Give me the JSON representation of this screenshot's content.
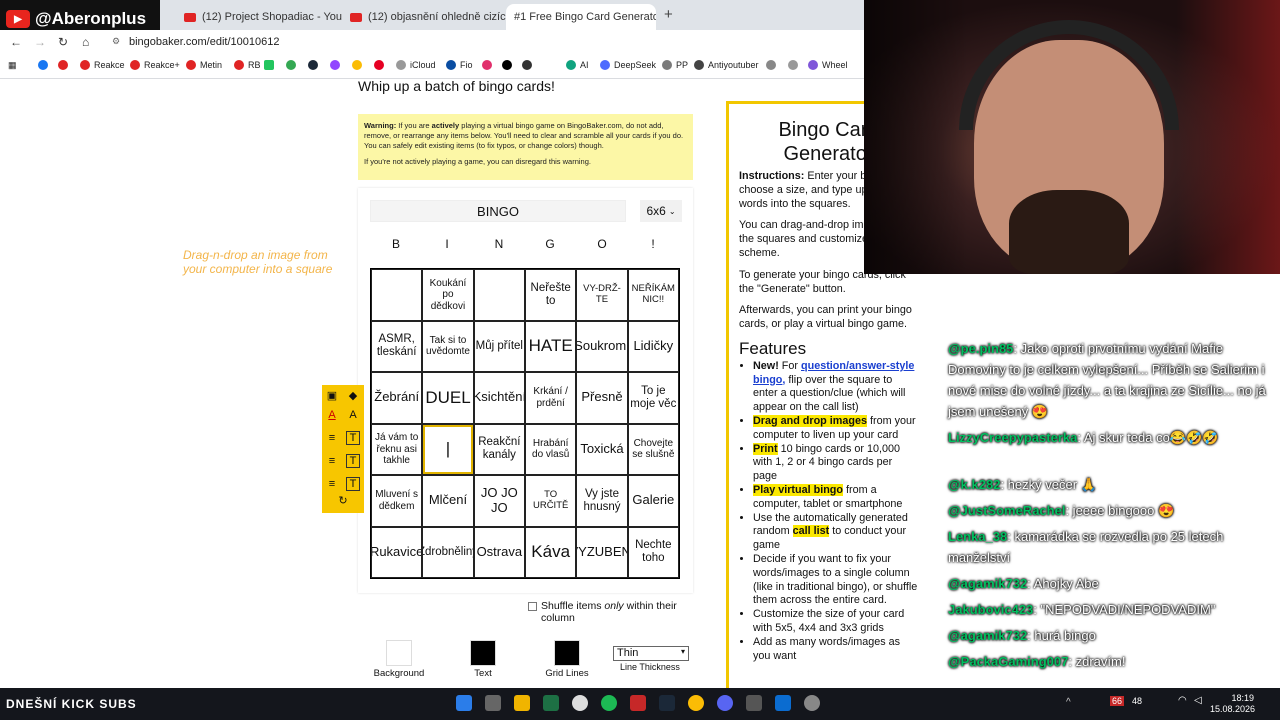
{
  "browser": {
    "tabs": [
      {
        "label": "(12) Project Shopadiac - YouTu"
      },
      {
        "label": "(12) objasnění ohledně cizích li"
      },
      {
        "label": "#1 Free Bingo Card Generator"
      }
    ],
    "url": "bingobaker.com/edit/10010612",
    "bookmarks": [
      "Reakce",
      "Reakce+",
      "Metin",
      "RB",
      "iCloud",
      "Fio",
      "AI",
      "DeepSeek",
      "PP",
      "Antiyoutuber",
      "Wheel"
    ]
  },
  "channel": {
    "name": "@Aberonplus"
  },
  "page": {
    "heading": "Whip up a batch of bingo cards!",
    "warning": {
      "label": "Warning:",
      "body_pre": " If you are ",
      "body_em": "actively",
      "body_post": " playing a virtual bingo game on BingoBaker.com, do not add, remove, or rearrange any items below. You'll need to clear and scramble all your cards if you do. You can safely edit existing items (to fix typos, or change colors) though.",
      "note": "If you're not actively playing a game, you can disregard this warning."
    },
    "card_title": "BINGO",
    "size": "6x6",
    "letters": [
      "B",
      "I",
      "N",
      "G",
      "O",
      "!"
    ],
    "grid": [
      [
        "",
        "Koukání po dědkovi",
        "",
        "Neřešte to",
        "VY-DRŽ-TE",
        "NEŘÍKÁM NIC!!"
      ],
      [
        "ASMR, tleskání",
        "Tak si to uvědomte",
        "Můj přítel",
        "HATE",
        "Soukromí",
        "Lidičky"
      ],
      [
        "Žebrání",
        "DUEL",
        "Ksichtění",
        "Krkání / prdění",
        "Přesně",
        "To je moje věc"
      ],
      [
        "Já vám to řeknu asi takhle",
        "|",
        "Reakční kanály",
        "Hrabání do vlasů",
        "Toxická",
        "Chovejte se slušně"
      ],
      [
        "Mluvení s dědkem",
        "Mlčení",
        "JO JO JO",
        "TO URČITĚ",
        "Vy jste hnusný",
        "Galerie"
      ],
      [
        "Rukavice",
        "Zdrobněliny",
        "Ostrava",
        "Káva",
        "VYZUBENÍ",
        "Nechte toho"
      ]
    ],
    "drag_hint": "Drag-n-drop an image from your computer into a square",
    "shuffle_pre": "Shuffle items ",
    "shuffle_em": "only",
    "shuffle_post": " within their column",
    "swatches": [
      {
        "label": "Background",
        "color": "#ffffff"
      },
      {
        "label": "Text",
        "color": "#000000"
      },
      {
        "label": "Grid Lines",
        "color": "#000000"
      }
    ],
    "thickness": {
      "value": "Thin",
      "label": "Line Thickness"
    }
  },
  "panel": {
    "title_line1": "Bingo Card",
    "title_line2": "Generator",
    "instructions_label": "Instructions:",
    "instructions": " Enter your bingo title, choose a size, and type up your words into the squares.",
    "dragdrop": "You can drag-and-drop images into the squares and customize the color scheme.",
    "generate": "To generate your bingo cards, click the \"Generate\" button.",
    "afterwards": "Afterwards, you can print your bingo cards, or play a virtual bingo game.",
    "features_title": "Features",
    "features": [
      {
        "pre": "",
        "bold": "New!",
        "mid": " For ",
        "link": "question/answer-style bingo,",
        "post": " flip over the square to enter a question/clue (which will appear on the call list)"
      },
      {
        "hl": "Drag and drop images",
        "post": " from your computer to liven up your card"
      },
      {
        "hl": "Print",
        "post": " 10 bingo cards or 10,000 with 1, 2 or 4 bingo cards per page"
      },
      {
        "hl": "Play virtual bingo",
        "post": " from a computer, tablet or smartphone"
      },
      {
        "pre": "Use the automatically generated random ",
        "hl": "call list",
        "post": " to conduct your game"
      },
      {
        "post": "Decide if you want to fix your words/images to a single column (like in traditional bingo), or shuffle them across the entire card."
      },
      {
        "post": "Customize the size of your card with 5x5, 4x4 and 3x3 grids"
      },
      {
        "post": "Add as many words/images as you want"
      }
    ]
  },
  "chat": [
    {
      "user": "@pe.pin85",
      "text": ": Jako oproti prvotnímu vydání Mafie Domoviny to je celkem vylepšení... Příběh se Salierim i nové mise do volné jízdy... a ta krajina ze Sicílie... no já jsem unešený 😍"
    },
    {
      "user": "LizzyCreepypasterka",
      "text": ": Aj skur teda co😂🤣🤣"
    },
    {
      "user": "@k.k282",
      "text": ": hezký večer 🙏"
    },
    {
      "user": "@JustSomeRachel",
      "text": ": jeeee bingooo 😍"
    },
    {
      "user": "Lenka_38",
      "text": ": kamarádka se rozvedla po 25 letech manželství"
    },
    {
      "user": "@agamik732",
      "text": ": Ahojky Abe"
    },
    {
      "user": "Jakubovic423",
      "text": ": \"NEPODVADI/NEPODVADIM\""
    },
    {
      "user": "@agamik732",
      "text": ": hurá bingo"
    },
    {
      "user": "@PackaGaming007",
      "text": ": zdravím!"
    }
  ],
  "taskbar": {
    "subs_label": "DNEŠNÍ KICK SUBS",
    "time": "18:19",
    "date": "15.08.2026",
    "badge1": "66",
    "badge2": "48"
  }
}
